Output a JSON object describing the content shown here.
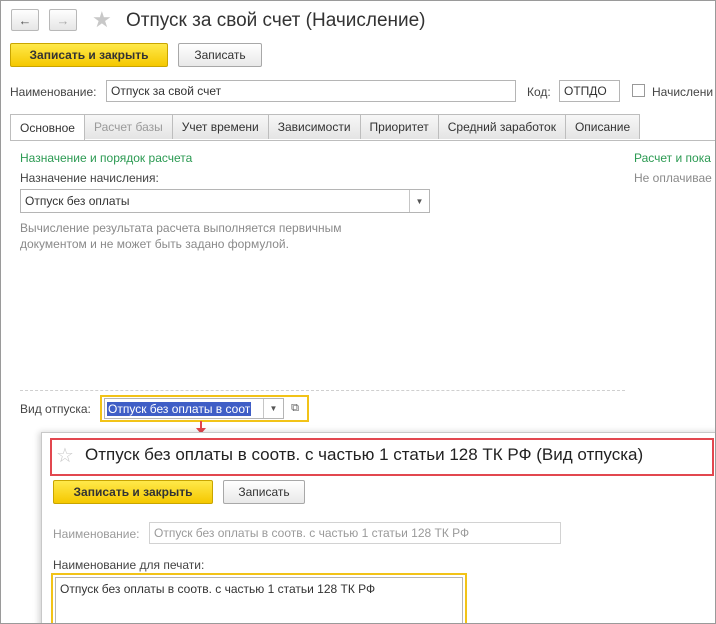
{
  "window": {
    "title": "Отпуск за свой счет (Начисление)",
    "back_icon": "arrow-left-icon",
    "forward_icon": "arrow-right-icon",
    "favorite_icon": "star-icon"
  },
  "toolbar": {
    "save_close_label": "Записать и закрыть",
    "save_label": "Записать"
  },
  "fields": {
    "name_label": "Наименование:",
    "name_value": "Отпуск за свой счет",
    "code_label": "Код:",
    "code_value": "ОТПДО",
    "checkbox_label": "Начислени"
  },
  "tabs": [
    {
      "label": "Основное"
    },
    {
      "label": "Расчет базы"
    },
    {
      "label": "Учет времени"
    },
    {
      "label": "Зависимости"
    },
    {
      "label": "Приоритет"
    },
    {
      "label": "Средний заработок"
    },
    {
      "label": "Описание"
    }
  ],
  "main": {
    "section_title": "Назначение и порядок расчета",
    "purpose_label": "Назначение начисления:",
    "purpose_value": "Отпуск без оплаты",
    "note_line1": "Вычисление результата расчета выполняется первичным",
    "note_line2": "документом и не может быть задано формулой.",
    "right_title": "Расчет и пока",
    "right_text": "Не оплачивае",
    "leave_type_label": "Вид отпуска:",
    "leave_type_value": "Отпуск без оплаты в соот"
  },
  "popup": {
    "title": "Отпуск без оплаты в соотв. с частью 1 статьи 128 ТК РФ (Вид отпуска)",
    "save_close_label": "Записать и закрыть",
    "save_label": "Записать",
    "name_label": "Наименование:",
    "name_value": "Отпуск без оплаты в соотв. с частью 1 статьи 128 ТК РФ",
    "print_label": "Наименование для печати:",
    "print_value": "Отпуск без оплаты в соотв. с частью 1 статьи 128 ТК РФ"
  },
  "colors": {
    "accent_yellow": "#f5c800",
    "highlight_red": "#e2474f",
    "section_green": "#2b9a52"
  }
}
